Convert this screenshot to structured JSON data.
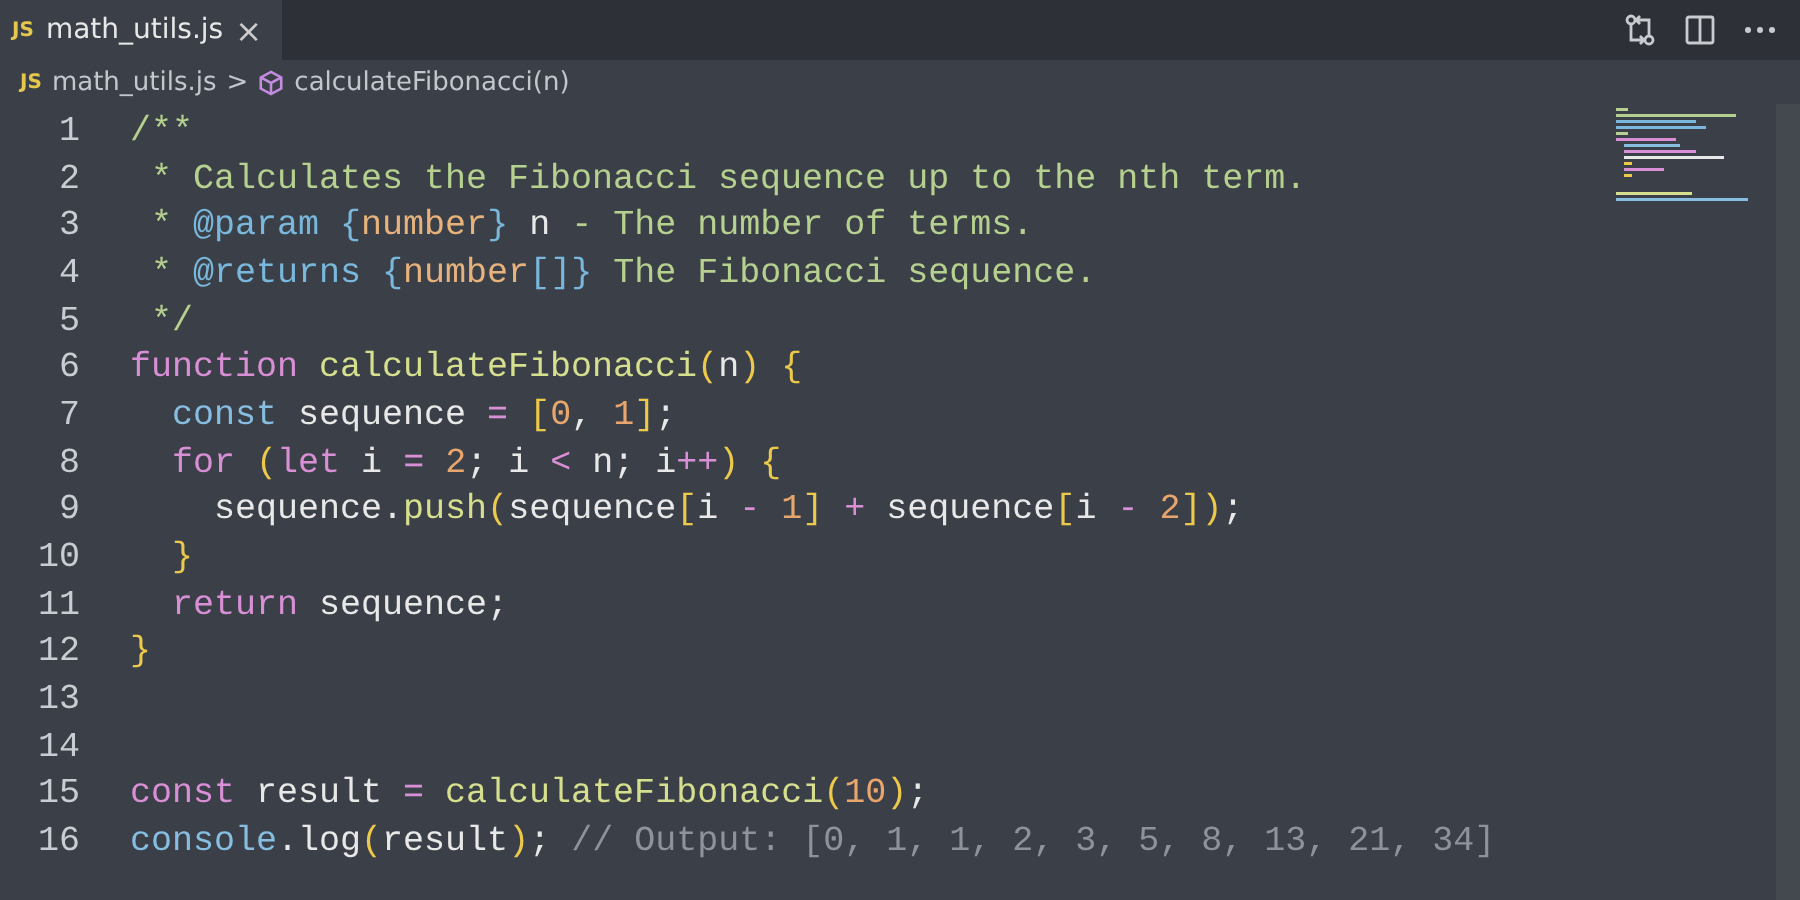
{
  "tab": {
    "icon": "JS",
    "title": "math_utils.js",
    "close": "×",
    "selected": true
  },
  "breadcrumb": {
    "icon": "JS",
    "file": "math_utils.js",
    "separator": ">",
    "symbol": "calculateFibonacci(n)"
  },
  "lines": [
    {
      "number": "1",
      "tokens": [
        {
          "text": "/**",
          "kind": "comment"
        }
      ]
    },
    {
      "number": "2",
      "tokens": [
        {
          "text": " * Calculates the Fibonacci sequence up to the nth term.",
          "kind": "comment"
        }
      ]
    },
    {
      "number": "3",
      "tokens": [
        {
          "text": " * ",
          "kind": "comment"
        },
        {
          "text": "@param",
          "kind": "tag"
        },
        {
          "text": " {",
          "kind": "tag"
        },
        {
          "text": "number",
          "kind": "type"
        },
        {
          "text": "}",
          "kind": "tag"
        },
        {
          "text": " n",
          "kind": "plain"
        },
        {
          "text": " - The number of terms.",
          "kind": "comment"
        }
      ]
    },
    {
      "number": "4",
      "tokens": [
        {
          "text": " * ",
          "kind": "comment"
        },
        {
          "text": "@returns",
          "kind": "tag"
        },
        {
          "text": " {",
          "kind": "tag"
        },
        {
          "text": "number",
          "kind": "type"
        },
        {
          "text": "[]}",
          "kind": "tag"
        },
        {
          "text": " The Fibonacci sequence.",
          "kind": "comment"
        }
      ]
    },
    {
      "number": "5",
      "tokens": [
        {
          "text": " */",
          "kind": "comment"
        }
      ]
    },
    {
      "number": "6",
      "tokens": [
        {
          "text": "function ",
          "kind": "keyword"
        },
        {
          "text": "calculateFibonacci",
          "kind": "function"
        },
        {
          "text": "(",
          "kind": "bracket"
        },
        {
          "text": "n",
          "kind": "plain"
        },
        {
          "text": ") {",
          "kind": "bracket"
        }
      ]
    },
    {
      "number": "7",
      "tokens": [
        {
          "text": "  const",
          "kind": "storage"
        },
        {
          "text": " sequence ",
          "kind": "plain"
        },
        {
          "text": "= ",
          "kind": "operator"
        },
        {
          "text": "[",
          "kind": "bracket"
        },
        {
          "text": "0",
          "kind": "number"
        },
        {
          "text": ", ",
          "kind": "plain"
        },
        {
          "text": "1",
          "kind": "number"
        },
        {
          "text": "]",
          "kind": "bracket"
        },
        {
          "text": ";",
          "kind": "plain"
        }
      ]
    },
    {
      "number": "8",
      "tokens": [
        {
          "text": "  for ",
          "kind": "keyword"
        },
        {
          "text": "(",
          "kind": "bracket"
        },
        {
          "text": "let",
          "kind": "keyword"
        },
        {
          "text": " i ",
          "kind": "plain"
        },
        {
          "text": "= ",
          "kind": "operator"
        },
        {
          "text": "2",
          "kind": "number"
        },
        {
          "text": "; i ",
          "kind": "plain"
        },
        {
          "text": "<",
          "kind": "operator"
        },
        {
          "text": " n; i",
          "kind": "plain"
        },
        {
          "text": "++",
          "kind": "operator"
        },
        {
          "text": ") {",
          "kind": "bracket"
        }
      ]
    },
    {
      "number": "9",
      "tokens": [
        {
          "text": "    sequence.",
          "kind": "plain"
        },
        {
          "text": "push",
          "kind": "function"
        },
        {
          "text": "(",
          "kind": "bracket"
        },
        {
          "text": "sequence",
          "kind": "plain"
        },
        {
          "text": "[",
          "kind": "bracket"
        },
        {
          "text": "i ",
          "kind": "plain"
        },
        {
          "text": "- ",
          "kind": "operator"
        },
        {
          "text": "1",
          "kind": "number"
        },
        {
          "text": "] ",
          "kind": "bracket"
        },
        {
          "text": "+",
          "kind": "operator"
        },
        {
          "text": " sequence",
          "kind": "plain"
        },
        {
          "text": "[",
          "kind": "bracket"
        },
        {
          "text": "i ",
          "kind": "plain"
        },
        {
          "text": "- ",
          "kind": "operator"
        },
        {
          "text": "2",
          "kind": "number"
        },
        {
          "text": "])",
          "kind": "bracket"
        },
        {
          "text": ";",
          "kind": "plain"
        }
      ]
    },
    {
      "number": "10",
      "tokens": [
        {
          "text": "  }",
          "kind": "bracket"
        }
      ]
    },
    {
      "number": "11",
      "tokens": [
        {
          "text": "  return",
          "kind": "keyword"
        },
        {
          "text": " sequence;",
          "kind": "plain"
        }
      ]
    },
    {
      "number": "12",
      "tokens": [
        {
          "text": "}",
          "kind": "bracket"
        }
      ]
    },
    {
      "number": "13"
    },
    {
      "number": "14"
    },
    {
      "number": "15",
      "tokens": [
        {
          "text": "const",
          "kind": "keyword"
        },
        {
          "text": " result ",
          "kind": "plain"
        },
        {
          "text": "= ",
          "kind": "operator"
        },
        {
          "text": "calculateFibonacci",
          "kind": "function"
        },
        {
          "text": "(",
          "kind": "bracket"
        },
        {
          "text": "10",
          "kind": "number"
        },
        {
          "text": ")",
          "kind": "bracket"
        },
        {
          "text": ";",
          "kind": "plain"
        }
      ]
    },
    {
      "number": "16",
      "tokens": [
        {
          "text": "console",
          "kind": "storage"
        },
        {
          "text": ".log",
          "kind": "plain"
        },
        {
          "text": "(",
          "kind": "bracket"
        },
        {
          "text": "result",
          "kind": "plain"
        },
        {
          "text": ")",
          "kind": "bracket"
        },
        {
          "text": "; ",
          "kind": "plain"
        },
        {
          "text": "// Output: [0, 1, 1, 2, 3, 5, 8, 13, 21, 34]",
          "kind": "note"
        }
      ]
    }
  ]
}
